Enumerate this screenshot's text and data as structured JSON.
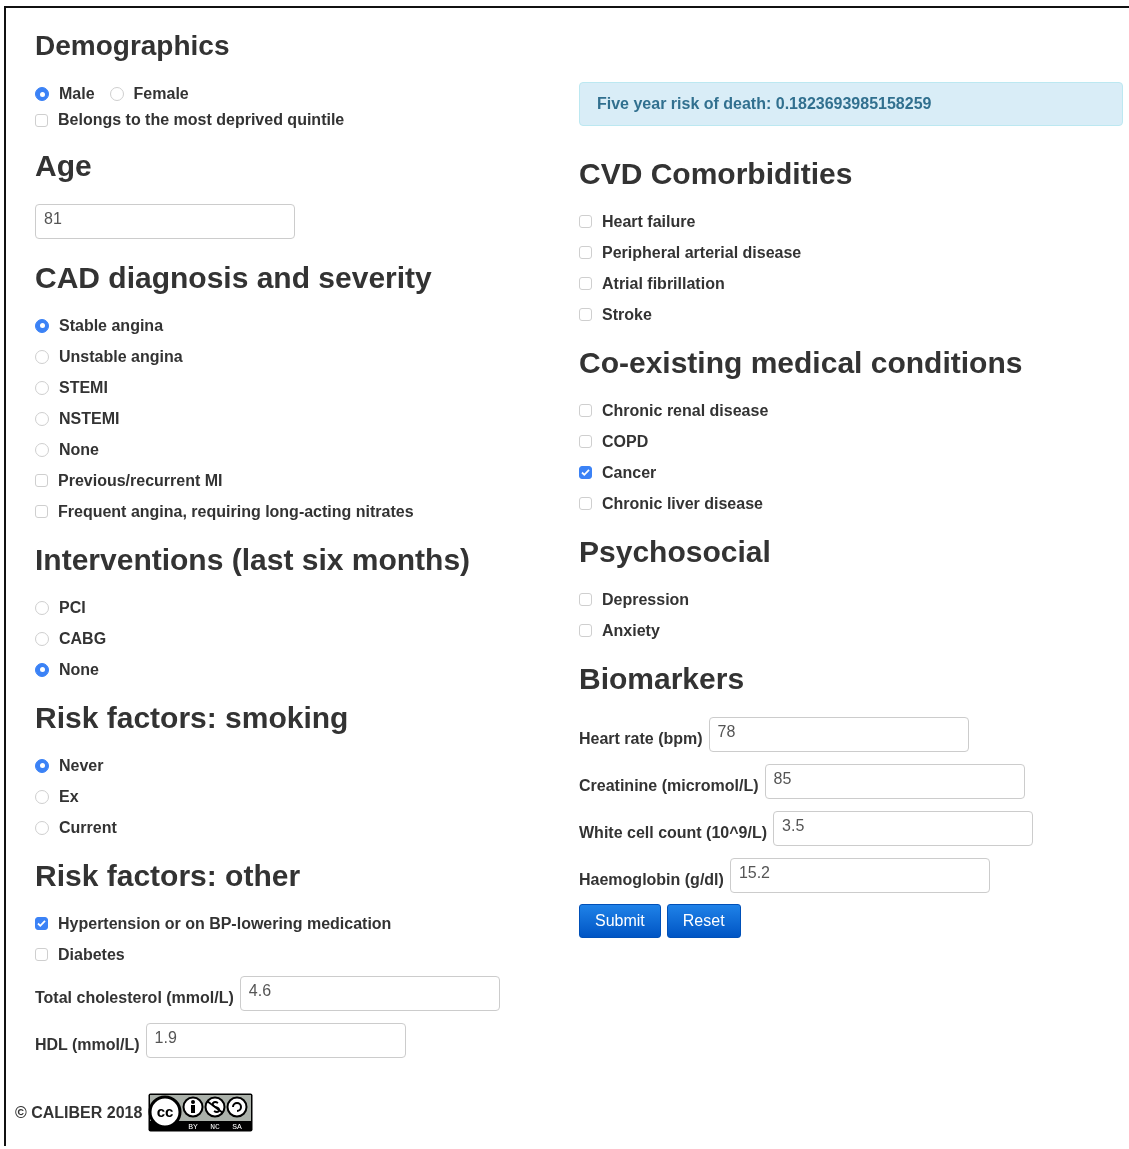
{
  "left": [
    {
      "heading": "Demographics",
      "items": [
        {
          "kind": "radio_row",
          "options": [
            {
              "label": "Male",
              "selected": true
            },
            {
              "label": "Female",
              "selected": false
            }
          ]
        },
        {
          "kind": "checkbox",
          "label": "Belongs to the most deprived quintile",
          "checked": false
        }
      ]
    },
    {
      "heading": "Age",
      "items": [
        {
          "kind": "field",
          "value": "81"
        }
      ]
    },
    {
      "heading": "CAD diagnosis and severity",
      "items": [
        {
          "kind": "radio",
          "label": "Stable angina",
          "selected": true
        },
        {
          "kind": "radio",
          "label": "Unstable angina",
          "selected": false
        },
        {
          "kind": "radio",
          "label": "STEMI",
          "selected": false
        },
        {
          "kind": "radio",
          "label": "NSTEMI",
          "selected": false
        },
        {
          "kind": "radio",
          "label": "None",
          "selected": false
        },
        {
          "kind": "checkbox",
          "label": "Previous/recurrent MI",
          "checked": false
        },
        {
          "kind": "checkbox",
          "label": "Frequent angina, requiring long-acting nitrates",
          "checked": false
        }
      ]
    },
    {
      "heading": "Interventions (last six months)",
      "items": [
        {
          "kind": "radio",
          "label": "PCI",
          "selected": false
        },
        {
          "kind": "radio",
          "label": "CABG",
          "selected": false
        },
        {
          "kind": "radio",
          "label": "None",
          "selected": true
        }
      ]
    },
    {
      "heading": "Risk factors: smoking",
      "items": [
        {
          "kind": "radio",
          "label": "Never",
          "selected": true
        },
        {
          "kind": "radio",
          "label": "Ex",
          "selected": false
        },
        {
          "kind": "radio",
          "label": "Current",
          "selected": false
        }
      ]
    },
    {
      "heading": "Risk factors: other",
      "items": [
        {
          "kind": "checkbox",
          "label": "Hypertension or on BP-lowering medication",
          "checked": true
        },
        {
          "kind": "checkbox",
          "label": "Diabetes",
          "checked": false
        },
        {
          "kind": "field",
          "label": "Total cholesterol (mmol/L)",
          "value": "4.6"
        },
        {
          "kind": "field",
          "label": "HDL (mmol/L)",
          "value": "1.9"
        }
      ]
    }
  ],
  "right": {
    "alert": "Five year risk of death: 0.1823693985158259",
    "sections": [
      {
        "heading": "CVD Comorbidities",
        "items": [
          {
            "kind": "checkbox",
            "label": "Heart failure",
            "checked": false
          },
          {
            "kind": "checkbox",
            "label": "Peripheral arterial disease",
            "checked": false
          },
          {
            "kind": "checkbox",
            "label": "Atrial fibrillation",
            "checked": false
          },
          {
            "kind": "checkbox",
            "label": "Stroke",
            "checked": false
          }
        ]
      },
      {
        "heading": "Co-existing medical conditions",
        "items": [
          {
            "kind": "checkbox",
            "label": "Chronic renal disease",
            "checked": false
          },
          {
            "kind": "checkbox",
            "label": "COPD",
            "checked": false
          },
          {
            "kind": "checkbox",
            "label": "Cancer",
            "checked": true
          },
          {
            "kind": "checkbox",
            "label": "Chronic liver disease",
            "checked": false
          }
        ]
      },
      {
        "heading": "Psychosocial",
        "items": [
          {
            "kind": "checkbox",
            "label": "Depression",
            "checked": false
          },
          {
            "kind": "checkbox",
            "label": "Anxiety",
            "checked": false
          }
        ]
      },
      {
        "heading": "Biomarkers",
        "items": [
          {
            "kind": "field",
            "label": "Heart rate (bpm)",
            "value": "78"
          },
          {
            "kind": "field",
            "label": "Creatinine (micromol/L)",
            "value": "85"
          },
          {
            "kind": "field",
            "label": "White cell count (10^9/L)",
            "value": "3.5"
          },
          {
            "kind": "field",
            "label": "Haemoglobin (g/dl)",
            "value": "15.2"
          }
        ]
      }
    ],
    "buttons": [
      "Submit",
      "Reset"
    ]
  },
  "footer": {
    "text": "© CALIBER 2018",
    "badge": {
      "symbol": "cc",
      "terms": [
        "BY",
        "NC",
        "SA"
      ]
    }
  }
}
